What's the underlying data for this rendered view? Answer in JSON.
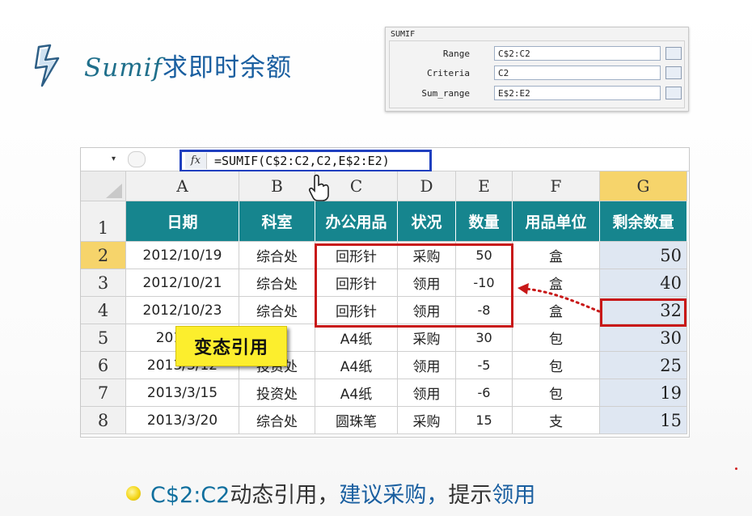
{
  "title": {
    "latin": "Sumif",
    "chinese": "求即时余额"
  },
  "dialog": {
    "title": "SUMIF",
    "rows": [
      {
        "label": "Range",
        "value": "C$2:C2"
      },
      {
        "label": "Criteria",
        "value": "C2"
      },
      {
        "label": "Sum_range",
        "value": "E$2:E2"
      }
    ],
    "ref_icon": "collapse-dialog-icon"
  },
  "formula_bar": {
    "fx": "fx",
    "formula": "=SUMIF(C$2:C2,C2,E$2:E2)"
  },
  "columns": [
    "A",
    "B",
    "C",
    "D",
    "E",
    "F",
    "G"
  ],
  "row_numbers": [
    "1",
    "2",
    "3",
    "4",
    "5",
    "6",
    "7",
    "8"
  ],
  "headers": [
    "日期",
    "科室",
    "办公用品",
    "状况",
    "数量",
    "用品单位",
    "剩余数量"
  ],
  "rows": [
    [
      "2012/10/19",
      "综合处",
      "回形针",
      "采购",
      "50",
      "盒",
      "50"
    ],
    [
      "2012/10/21",
      "综合处",
      "回形针",
      "领用",
      "-10",
      "盒",
      "40"
    ],
    [
      "2012/10/23",
      "综合处",
      "回形针",
      "领用",
      "-8",
      "盒",
      "32"
    ],
    [
      "2013/3/",
      "处",
      "A4纸",
      "采购",
      "30",
      "包",
      "30"
    ],
    [
      "2013/3/12",
      "投资处",
      "A4纸",
      "领用",
      "-5",
      "包",
      "25"
    ],
    [
      "2013/3/15",
      "投资处",
      "A4纸",
      "领用",
      "-6",
      "包",
      "19"
    ],
    [
      "2013/3/20",
      "综合处",
      "圆珠笔",
      "采购",
      "15",
      "支",
      "15"
    ]
  ],
  "badge": "变态引用",
  "footer": {
    "part1": "C$2:C2",
    "part2": "动态引用，",
    "part3": "建议采购，",
    "part4": "提示",
    "part5": "领用"
  },
  "colors": {
    "header_teal": "#16858e",
    "highlight_red": "#c81818",
    "formula_blue": "#1f3fbf",
    "badge_yellow": "#fcee2d"
  }
}
